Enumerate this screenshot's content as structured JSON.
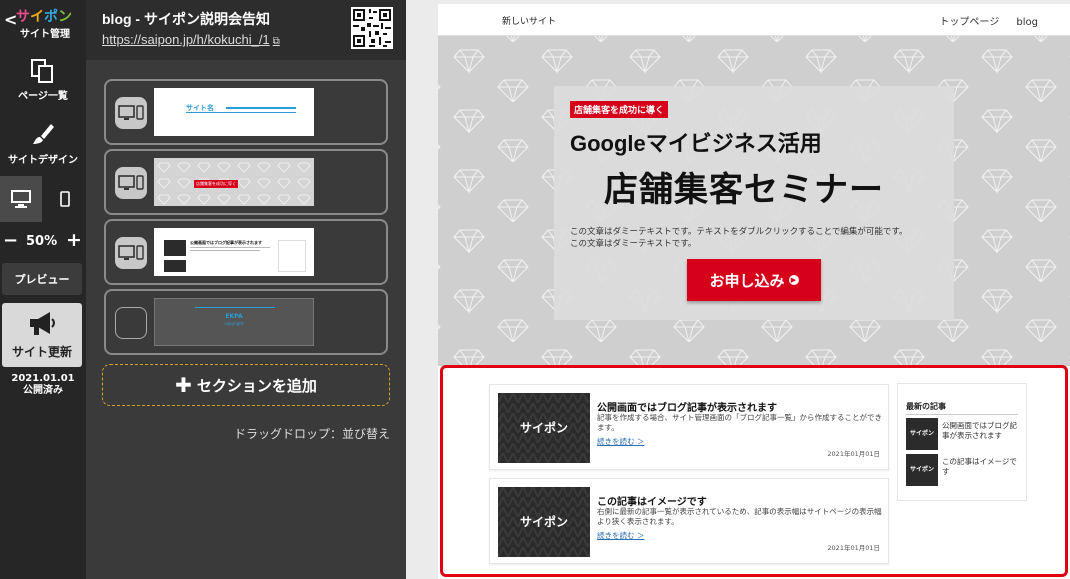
{
  "rail": {
    "logo_back": "<",
    "logo_text": [
      "サ",
      "イ",
      "ポ",
      "ン",
      ""
    ],
    "logo_sub": "サイト管理",
    "pages_label": "ページ一覧",
    "design_label": "サイトデザイン",
    "zoom_minus": "−",
    "zoom_value": "50%",
    "zoom_plus": "+",
    "preview_label": "プレビュー",
    "update_label": "サイト更新",
    "publish_date": "2021.01.01",
    "publish_status": "公開済み"
  },
  "panel": {
    "title": "blog - サイポン説明会告知",
    "url": "https://saipon.jp/h/kokuchi_/1",
    "add_section_label": "セクションを追加",
    "drag_hint": "ドラッグドロップ：並び替え",
    "thumbs": {
      "header_site_name": "サイト名",
      "hero_tag": "店舗集客を成功に導く",
      "blog_title": "公開画面ではブログ記事が表示されます",
      "footer_logo": "EKPA",
      "footer_copy": "copyright"
    }
  },
  "site": {
    "name": "新しいサイト",
    "nav": [
      "トップページ",
      "blog"
    ],
    "hero": {
      "tag": "店舗集客を成功に導く",
      "line1": "Googleマイビジネス活用",
      "line2": "店舗集客セミナー",
      "desc1": "この文章はダミーテキストです。テキストをダブルクリックすることで編集が可能です。",
      "desc2": "この文章はダミーテキストです。",
      "cta": "お申し込み",
      "cta_arrow": "▶"
    },
    "posts": [
      {
        "image_label": "サイポン",
        "title": "公開画面ではブログ記事が表示されます",
        "body": "記事を作成する場合、サイト管理画面の「ブログ記事一覧」から作成することができます。",
        "more": "続きを読む ＞",
        "date": "2021年01月01日"
      },
      {
        "image_label": "サイポン",
        "title": "この記事はイメージです",
        "body": "右側に最新の記事一覧が表示されているため、記事の表示幅はサイトページの表示幅より狭く表示されます。",
        "more": "続きを読む ＞",
        "date": "2021年01月01日"
      }
    ],
    "sidebar": {
      "heading": "最新の記事",
      "items": [
        {
          "image_label": "サイポン",
          "text": "公開画面ではブログ記事が表示されます"
        },
        {
          "image_label": "サイポン",
          "text": "この記事はイメージです"
        }
      ]
    }
  },
  "colors": {
    "accent_red": "#d7001b",
    "selection_red": "#e00012",
    "add_section_border": "#d6a22a",
    "rail_bg": "#262626"
  }
}
